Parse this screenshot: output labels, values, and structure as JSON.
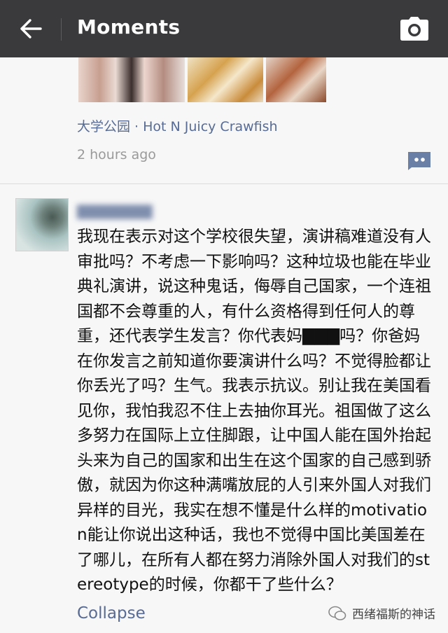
{
  "header": {
    "title": "Moments",
    "back_icon": "arrow-left-icon",
    "camera_icon": "camera-icon"
  },
  "post": {
    "location": "大学公园 · Hot N Juicy Crawfish",
    "time_ago": "2 hours ago"
  },
  "comment": {
    "username": "▇▇▇▇▇▇▇",
    "text": "我现在表示对这个学校很失望，演讲稿难道没有人审批吗？不考虑一下影响吗？这种垃圾也能在毕业典礼演讲，说这种鬼话，侮辱自己国家，一个连祖国都不会尊重的人，有什么资格得到任何人的尊重，还代表学生发言？你代表妈▇▇▇吗？你爸妈在你发言之前知道你要演讲什么吗？不觉得脸都让你丢光了吗？生气。我表示抗议。别让我在美国看见你，我怕我忍不住上去抽你耳光。祖国做了这么多努力在国际上立住脚跟，让中国人能在国外抬起头来为自己的国家和出生在这个国家的自己感到骄傲，就因为你这种满嘴放屁的人引来外国人对我们异样的目光，我实在想不懂是什么样的motivation能让你说出这种话，我也不觉得中国比美国差在了哪儿，在所有人都在努力消除外国人对我们的stereotype的时候，你都干了些什么？",
    "collapse_label": "Collapse"
  },
  "watermark": {
    "text": "西绪福斯的神话"
  },
  "colors": {
    "topbar": "#3a3a3c",
    "link": "#576b95",
    "muted": "#9a9a9a"
  }
}
